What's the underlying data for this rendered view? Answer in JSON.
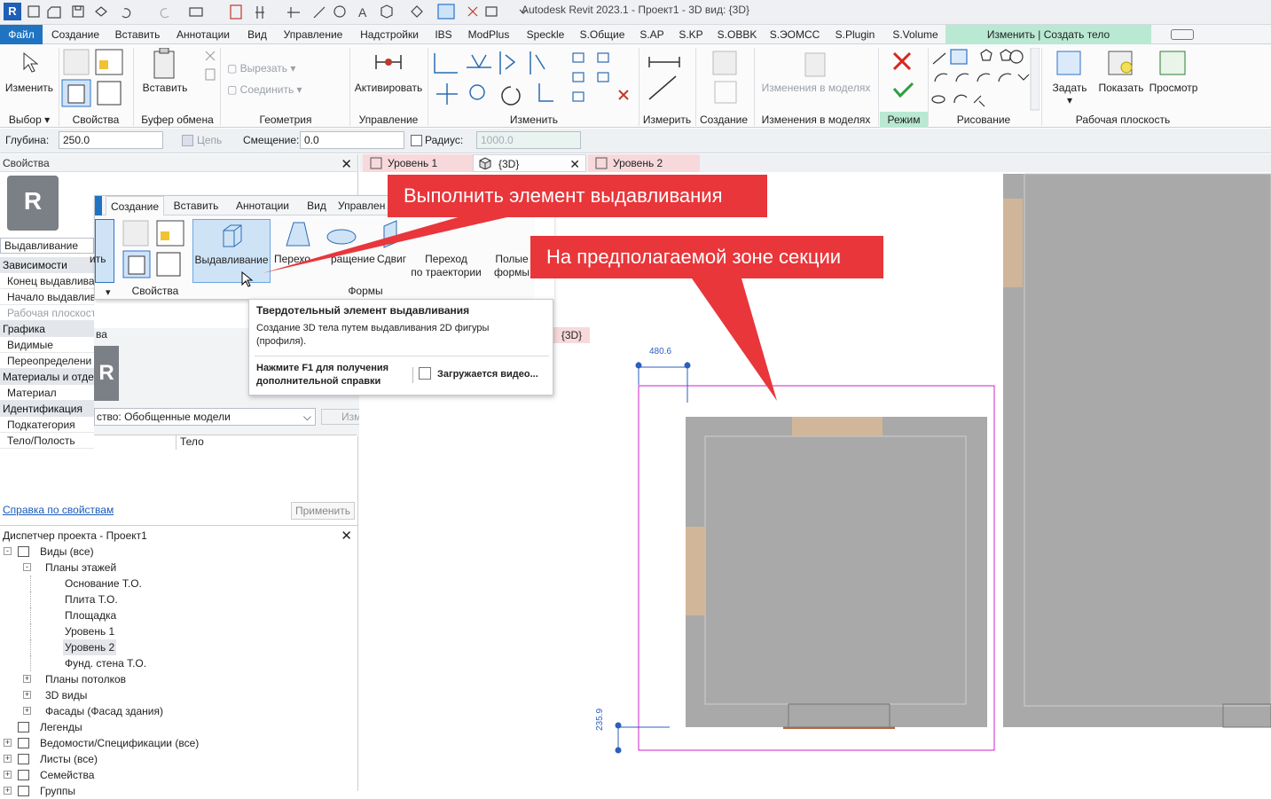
{
  "app": {
    "title": "Autodesk Revit 2023.1 - Проект1 - 3D вид: {3D}",
    "logo_letter": "R"
  },
  "tabs": [
    "Файл",
    "Создание",
    "Вставить",
    "Аннотации",
    "Вид",
    "Управление",
    "Надстройки",
    "IBS",
    "ModPlus",
    "Speckle",
    "S.Общие",
    "S.AP",
    "S.KP",
    "S.OBBK",
    "S.ЭОМСС",
    "S.Plugin",
    "S.Volume"
  ],
  "context_tab": "Изменить | Создать тело выдавливания",
  "ribbon": {
    "modify_label": "Изменить",
    "paste_label": "Вставить",
    "cut_label": "Вырезать",
    "join_label": "Соединить",
    "activate_label": "Активировать",
    "measure_label": "Измерить",
    "create_label": "Создание",
    "model_changes_label": "Изменения в моделях",
    "set_label": "Задать",
    "show_label": "Показать",
    "viewer_label": "Просмотр",
    "panels": {
      "select": "Выбор",
      "properties": "Свойства",
      "clipboard": "Буфер обмена",
      "geometry": "Геометрия",
      "control": "Управление",
      "modify": "Изменить",
      "measure": "Измерить",
      "create": "Создание",
      "model_changes": "Изменения в моделях",
      "mode": "Режим",
      "draw": "Рисование",
      "workplane": "Рабочая плоскость"
    }
  },
  "options": {
    "depth_label": "Глубина:",
    "depth_value": "250.0",
    "chain_label": "Цепь",
    "offset_label": "Смещение:",
    "offset_value": "0.0",
    "radius_label": "Радиус:",
    "radius_value": "1000.0"
  },
  "properties": {
    "title": "Свойства",
    "type_name": "Выдавливание",
    "rows": [
      {
        "kind": "cat",
        "text": "Зависимости"
      },
      {
        "kind": "row",
        "text": "Конец выдавлива"
      },
      {
        "kind": "row",
        "text": "Начало выдавлив"
      },
      {
        "kind": "row",
        "text": "Рабочая плоскост",
        "dim": true
      },
      {
        "kind": "cat",
        "text": "Графика"
      },
      {
        "kind": "row",
        "text": "Видимые"
      },
      {
        "kind": "row",
        "text": "Переопределени"
      },
      {
        "kind": "cat",
        "text": "Материалы и отде"
      },
      {
        "kind": "row",
        "text": "Материал"
      },
      {
        "kind": "cat",
        "text": "Идентификация"
      },
      {
        "kind": "row",
        "text": "Подкатегория"
      },
      {
        "kind": "row",
        "text": "Тело/Полость"
      }
    ],
    "second_title_fragment": "ва",
    "family_select": "ство: Обобщенные модели",
    "edit_type": "Изменить тип",
    "solid_value": "Тело",
    "help_link": "Справка по свойствам",
    "apply": "Применить"
  },
  "browser": {
    "title": "Диспетчер проекта - Проект1",
    "items": [
      {
        "level": 0,
        "exp": "-",
        "icon": "view",
        "text": "Виды (все)"
      },
      {
        "level": 1,
        "exp": "-",
        "icon": "",
        "text": "Планы этажей"
      },
      {
        "level": 2,
        "exp": "",
        "icon": "",
        "text": "Основание Т.О."
      },
      {
        "level": 2,
        "exp": "",
        "icon": "",
        "text": "Плита Т.О."
      },
      {
        "level": 2,
        "exp": "",
        "icon": "",
        "text": "Площадка"
      },
      {
        "level": 2,
        "exp": "",
        "icon": "",
        "text": "Уровень 1"
      },
      {
        "level": 2,
        "exp": "",
        "icon": "",
        "text": "Уровень 2",
        "sel": true
      },
      {
        "level": 2,
        "exp": "",
        "icon": "",
        "text": "Фунд. стена Т.О."
      },
      {
        "level": 1,
        "exp": "+",
        "icon": "",
        "text": "Планы потолков"
      },
      {
        "level": 1,
        "exp": "+",
        "icon": "",
        "text": "3D виды"
      },
      {
        "level": 1,
        "exp": "+",
        "icon": "",
        "text": "Фасады (Фасад здания)"
      },
      {
        "level": 0,
        "exp": "",
        "icon": "legend",
        "text": "Легенды"
      },
      {
        "level": 0,
        "exp": "+",
        "icon": "table",
        "text": "Ведомости/Спецификации (все)"
      },
      {
        "level": 0,
        "exp": "+",
        "icon": "sheet",
        "text": "Листы (все)"
      },
      {
        "level": 0,
        "exp": "+",
        "icon": "family",
        "text": "Семейства"
      },
      {
        "level": 0,
        "exp": "+",
        "icon": "group",
        "text": "Группы"
      }
    ]
  },
  "view_tabs": [
    {
      "label": "Уровень 1",
      "icon": "plan"
    },
    {
      "label": "{3D}",
      "icon": "cube",
      "closable": true
    },
    {
      "label": "Уровень 2",
      "icon": "plan"
    }
  ],
  "overlay": {
    "tabs": [
      "Создание",
      "Вставить",
      "Аннотации",
      "Вид",
      "Управлен"
    ],
    "fragment_left": "ить",
    "extrusion": "Выдавливание",
    "blend_fragment": "Перехо",
    "revolve_fragment": "ращение",
    "sweep": "Сдвиг",
    "sweep_blend_1": "Переход",
    "sweep_blend_2": "по траектории",
    "void_1": "Полые",
    "void_2": "формы",
    "props_panel": "Свойства",
    "forms_panel": "Формы",
    "tab_3d_label": "{3D}"
  },
  "tooltip": {
    "title": "Твердотельный элемент выдавливания",
    "body": "Создание 3D тела путем выдавливания 2D фигуры (профиля).",
    "f1": "Нажмите F1 для получения дополнительной справки",
    "video": "Загружается видео..."
  },
  "callouts": {
    "first": "Выполнить элемент выдавливания",
    "second": "На предполагаемой зоне секции"
  },
  "dims": {
    "top": "480.6",
    "left": "235.9"
  },
  "colors": {
    "file_tab": "#1f73c1",
    "context_tab": "#b9e8d3",
    "callout": "#e8363a",
    "sketch": "#d020c8",
    "dimension": "#2b5fbd",
    "floor": "#a9a9a9",
    "door": "#d9b896"
  }
}
